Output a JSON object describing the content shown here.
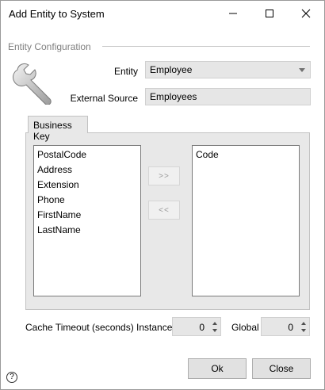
{
  "window": {
    "title": "Add Entity to System",
    "minimize_icon": "minimize-icon",
    "maximize_icon": "maximize-icon",
    "close_icon": "close-icon"
  },
  "config": {
    "section_label": "Entity Configuration",
    "icon": "wrench-icon",
    "entity_label": "Entity",
    "entity_value": "Employee",
    "external_source_label": "External Source",
    "external_source_value": "Employees"
  },
  "business_key": {
    "tab_label": "Business Key",
    "available": [
      "PostalCode",
      "Address",
      "Extension",
      "Phone",
      "FirstName",
      "LastName"
    ],
    "selected": [
      "Code"
    ],
    "add_label": ">>",
    "remove_label": "<<"
  },
  "cache": {
    "label": "Cache Timeout (seconds)",
    "instance_label": "Instance",
    "instance_value": "0",
    "global_label": "Global",
    "global_value": "0"
  },
  "footer": {
    "ok_label": "Ok",
    "close_label": "Close",
    "help_icon": "help-icon",
    "help_glyph": "?"
  },
  "colors": {
    "panel_bg": "#e8e8e8",
    "field_bg": "#e6e6e6",
    "section_text": "#808080"
  }
}
